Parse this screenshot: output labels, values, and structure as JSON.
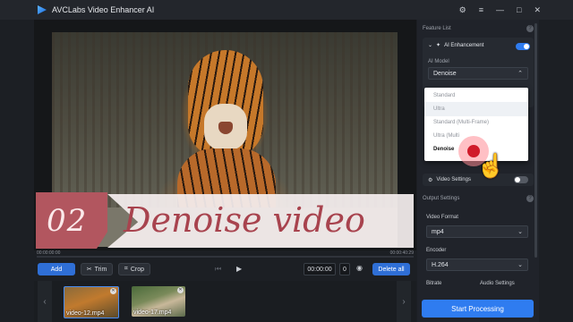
{
  "app": {
    "title": "AVCLabs Video Enhancer AI",
    "window_controls": [
      "⚙",
      "≡",
      "—",
      "□",
      "✕"
    ]
  },
  "banner": {
    "number": "02",
    "text": "Denoise video",
    "colors": {
      "accent": "#b2565f",
      "text": "#a8434e"
    }
  },
  "timeline": {
    "start": "00:00:00:00",
    "end": "00:00:40:29"
  },
  "toolbar": {
    "add": "Add",
    "trim": "Trim",
    "crop": "Crop",
    "time": "00:00:00",
    "count": "0",
    "delete_all": "Delete all"
  },
  "files": [
    {
      "name": "video-12.mp4"
    },
    {
      "name": "video-17.mp4"
    }
  ],
  "panel": {
    "feature_list": "Feature List",
    "ai_enhancement": "AI Enhancement",
    "ai_model_label": "AI Model",
    "ai_model_value": "Denoise",
    "model_options": [
      "Standard",
      "Ultra",
      "Standard (Multi-Frame)",
      "Ultra (Multi",
      "Denoise"
    ],
    "video_settings": "Video Settings",
    "output_settings": "Output Settings",
    "video_format_label": "Video Format",
    "video_format_value": "mp4",
    "encoder_label": "Encoder",
    "encoder_value": "H.264",
    "bitrate_label": "Bitrate",
    "audio_settings_label": "Audio Settings",
    "start": "Start Processing"
  }
}
